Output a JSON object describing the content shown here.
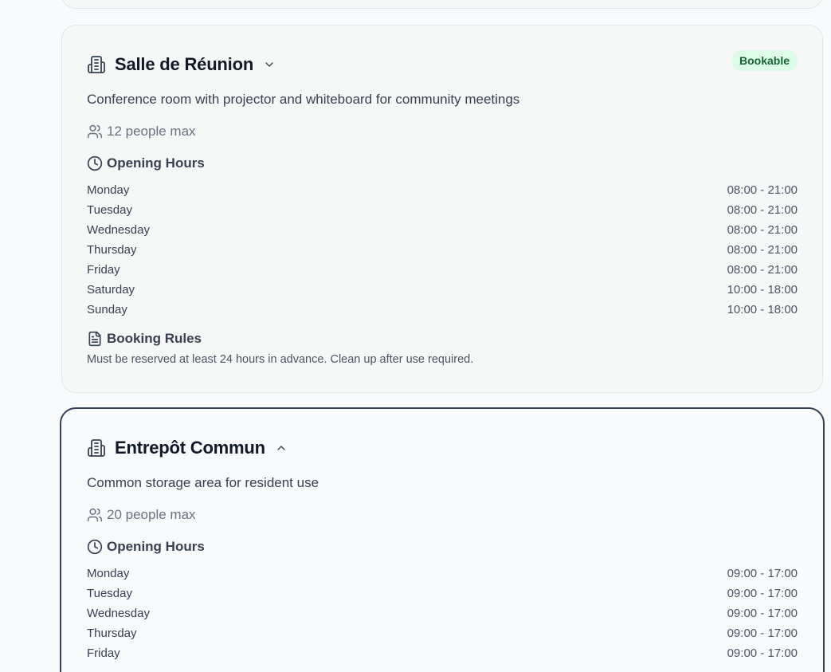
{
  "spaces": [
    {
      "name": "Salle de Réunion",
      "badge": "Bookable",
      "description": "Conference room with projector and whiteboard for community meetings",
      "capacity": "12 people max",
      "opening_hours_label": "Opening Hours",
      "hours": [
        {
          "day": "Monday",
          "time": "08:00 - 21:00"
        },
        {
          "day": "Tuesday",
          "time": "08:00 - 21:00"
        },
        {
          "day": "Wednesday",
          "time": "08:00 - 21:00"
        },
        {
          "day": "Thursday",
          "time": "08:00 - 21:00"
        },
        {
          "day": "Friday",
          "time": "08:00 - 21:00"
        },
        {
          "day": "Saturday",
          "time": "10:00 - 18:00"
        },
        {
          "day": "Sunday",
          "time": "10:00 - 18:00"
        }
      ],
      "booking_rules_label": "Booking Rules",
      "booking_rules": "Must be reserved at least 24 hours in advance. Clean up after use required.",
      "expanded": false
    },
    {
      "name": "Entrepôt Commun",
      "description": "Common storage area for resident use",
      "capacity": "20 people max",
      "opening_hours_label": "Opening Hours",
      "hours": [
        {
          "day": "Monday",
          "time": "09:00 - 17:00"
        },
        {
          "day": "Tuesday",
          "time": "09:00 - 17:00"
        },
        {
          "day": "Wednesday",
          "time": "09:00 - 17:00"
        },
        {
          "day": "Thursday",
          "time": "09:00 - 17:00"
        },
        {
          "day": "Friday",
          "time": "09:00 - 17:00"
        }
      ],
      "expanded": true
    }
  ],
  "colors": {
    "badge_bg": "#dcfce7",
    "badge_text": "#166534",
    "selected_border": "#334155"
  },
  "icons": {
    "building": "building-icon",
    "users": "users-icon",
    "clock": "clock-icon",
    "document": "document-icon",
    "chevron_down": "chevron-down-icon",
    "chevron_up": "chevron-up-icon"
  }
}
